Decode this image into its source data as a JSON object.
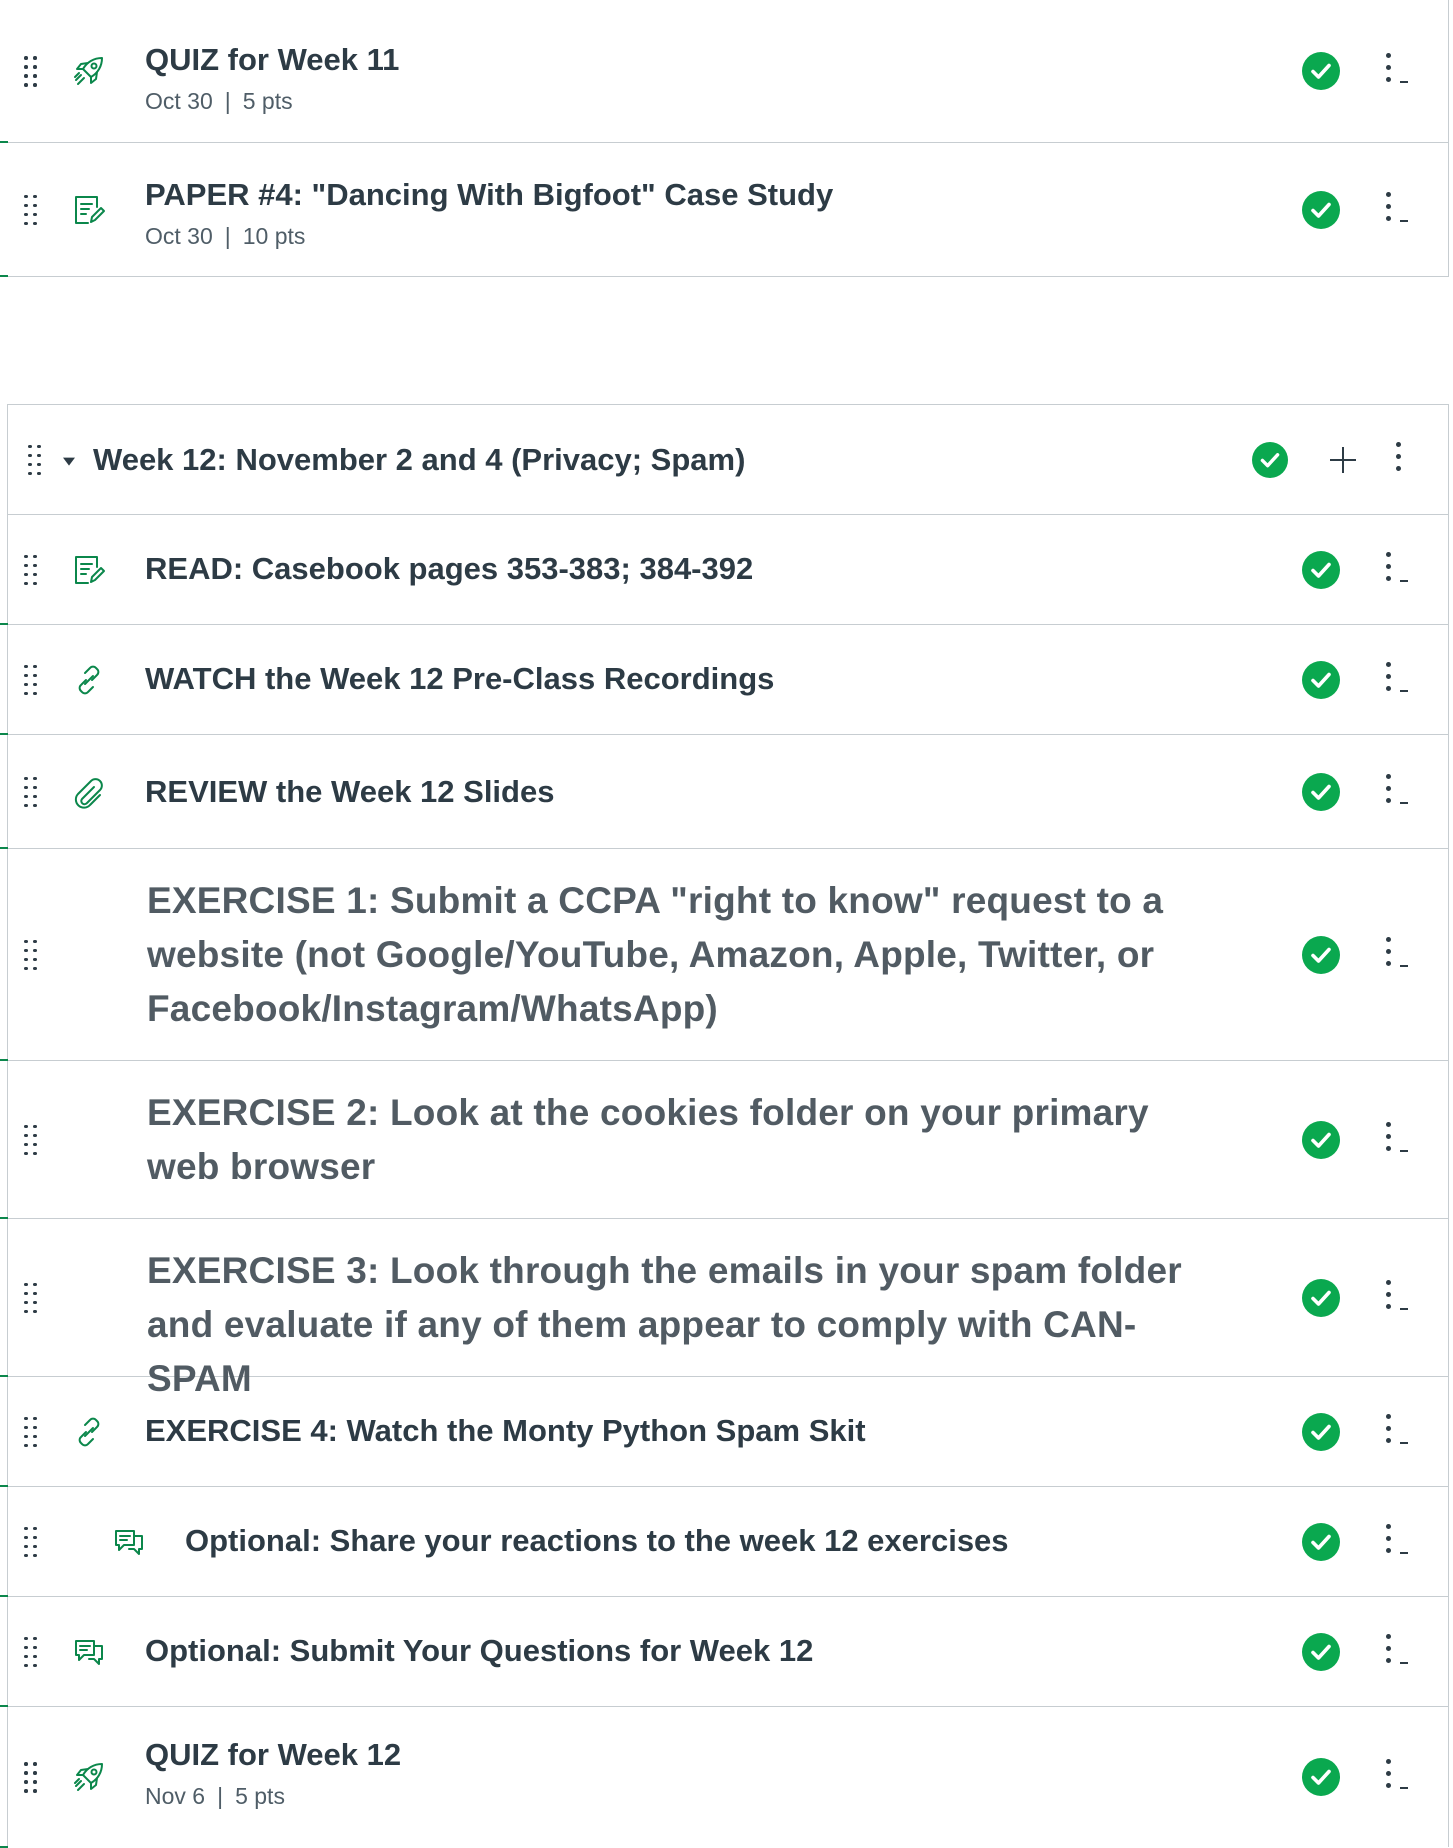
{
  "module_week11": {
    "items": [
      {
        "icon": "quiz-rocket-icon",
        "title": "QUIZ for Week 11",
        "date": "Oct 30",
        "sep": "|",
        "points": "5 pts"
      },
      {
        "icon": "assignment-icon",
        "title": "PAPER #4: \"Dancing With Bigfoot\" Case Study",
        "date": "Oct 30",
        "sep": "|",
        "points": "10 pts"
      }
    ]
  },
  "module_week12": {
    "title": "Week 12: November 2 and 4 (Privacy; Spam)",
    "items": [
      {
        "icon": "assignment-icon",
        "title": "READ: Casebook pages 353-383; 384-392"
      },
      {
        "icon": "link-icon",
        "title": "WATCH the Week 12 Pre-Class Recordings"
      },
      {
        "icon": "attachment-icon",
        "title": "REVIEW the Week 12 Slides"
      },
      {
        "icon": "none",
        "title": "EXERCISE 1: Submit a CCPA \"right to know\" request to a website (not Google/YouTube, Amazon, Apple, Twitter, or Facebook/Instagram/WhatsApp)"
      },
      {
        "icon": "none",
        "title": "EXERCISE 2: Look at the cookies folder on your primary web browser"
      },
      {
        "icon": "none",
        "title": "EXERCISE 3: Look through the emails in your spam folder and evaluate if any of them appear to comply with CAN-SPAM"
      },
      {
        "icon": "link-icon",
        "title": "EXERCISE 4: Watch the Monty Python Spam Skit"
      },
      {
        "icon": "discussion-icon",
        "title": "Optional: Share your reactions to the week 12 exercises"
      },
      {
        "icon": "discussion-icon",
        "title": "Optional: Submit Your Questions for Week 12"
      },
      {
        "icon": "quiz-rocket-icon",
        "title": "QUIZ for Week 12",
        "date": "Nov 6",
        "sep": "|",
        "points": "5 pts"
      }
    ]
  },
  "colors": {
    "accent": "#0b874b",
    "published": "#0aa84f",
    "text": "#2d3b45",
    "border": "#c7cdd1"
  }
}
